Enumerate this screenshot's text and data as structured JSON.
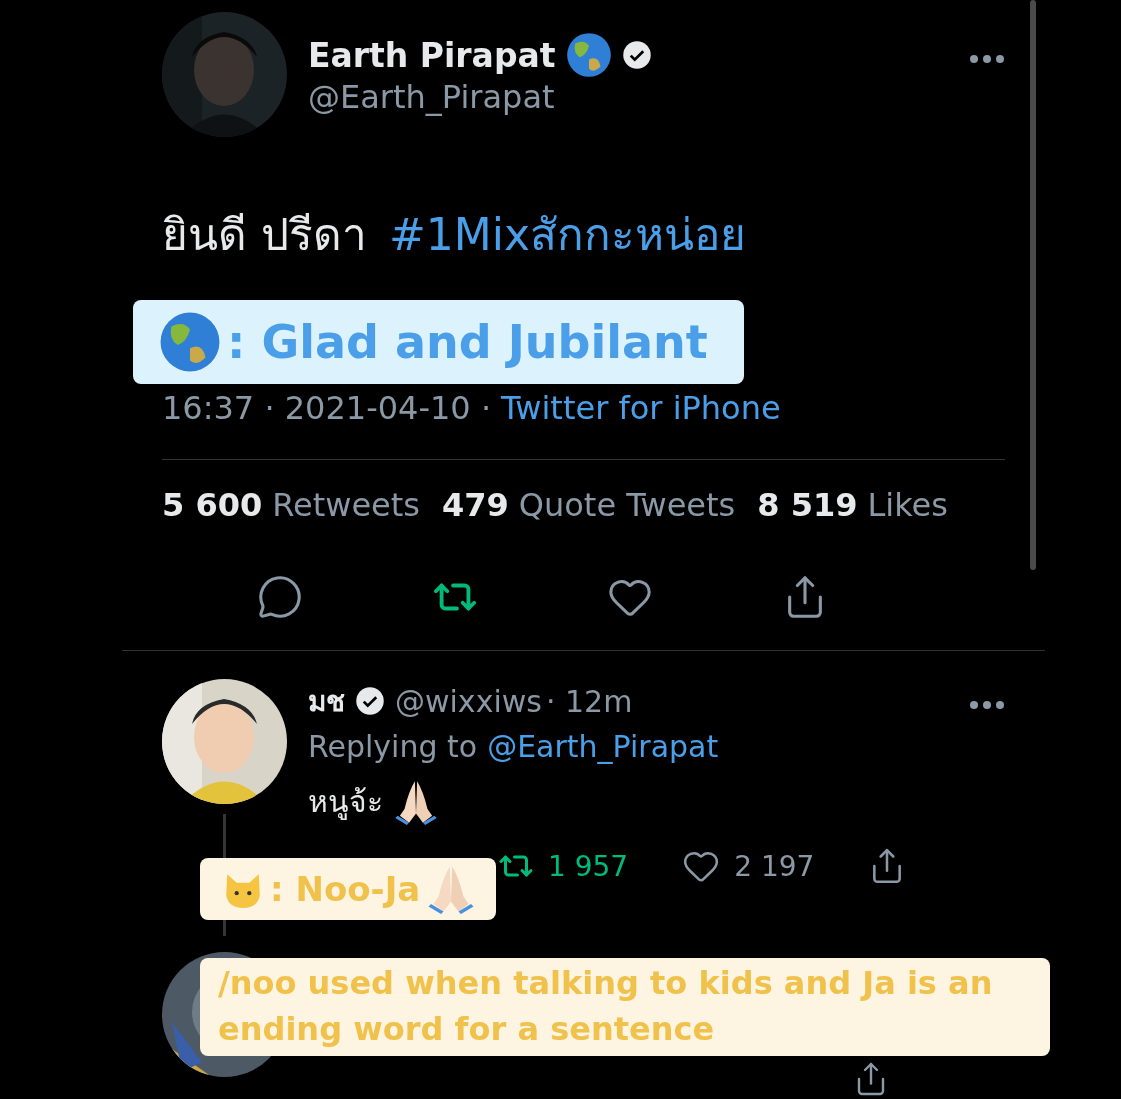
{
  "tweet": {
    "name": "Earth Pirapat",
    "handle": "@Earth_Pirapat",
    "verified": true,
    "text": "ยินดี ปรีดา",
    "hashtag": "#1Mixสักกะหน่อย",
    "time": "16:37 · 2021-04-10 ·",
    "source": "Twitter for iPhone",
    "retweeted": true,
    "stats": [
      {
        "count": "5 600",
        "label": "Retweets"
      },
      {
        "count": "479",
        "label": "Quote Tweets"
      },
      {
        "count": "8 519",
        "label": "Likes"
      }
    ]
  },
  "replies": [
    {
      "kind": "full",
      "name": "มช",
      "verified": true,
      "handle": "@wixxiws",
      "time": "· 12m",
      "replying_label": "Replying to",
      "replying_to": "@Earth_Pirapat",
      "text": "หนูจ้ะ",
      "retweets": "1 957",
      "retweeted": true,
      "likes": "2 197"
    },
    {
      "kind": "covered"
    }
  ],
  "annotations": [
    {
      "kind": "label",
      "text": ": Glad and Jubilant",
      "color": "#4a9fe8"
    },
    {
      "kind": "label",
      "text": ": Noo-Ja",
      "color": "#f0c14b"
    },
    {
      "kind": "note",
      "text": "/noo used when talking to kids and Ja is an ending word for a sentence",
      "color": "#f0c14b"
    }
  ]
}
